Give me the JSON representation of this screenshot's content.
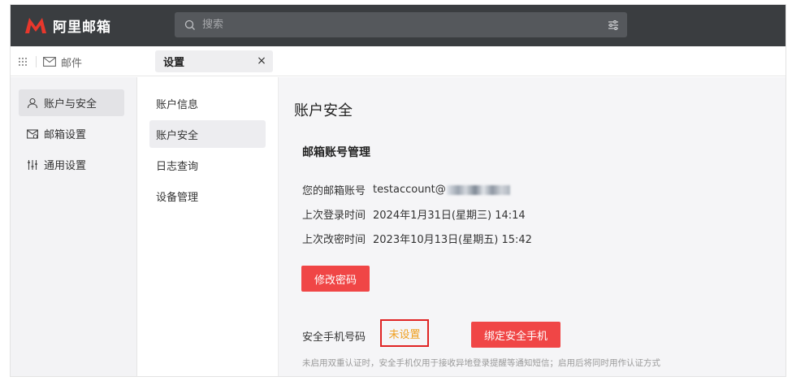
{
  "header": {
    "logo_text": "阿里邮箱",
    "search_placeholder": "搜索",
    "colors": {
      "bar": "#3a3d40",
      "brand_red": "#e8372c",
      "accent_red": "#f04646"
    }
  },
  "tabs": {
    "mail_label": "邮件",
    "settings_label": "设置",
    "close_glyph": "×"
  },
  "left_nav": {
    "items": [
      {
        "label": "账户与安全",
        "icon": "user-icon",
        "active": true
      },
      {
        "label": "邮箱设置",
        "icon": "mail-settings-icon",
        "active": false
      },
      {
        "label": "通用设置",
        "icon": "sliders-icon",
        "active": false
      }
    ]
  },
  "sub_nav": {
    "items": [
      {
        "label": "账户信息",
        "active": false
      },
      {
        "label": "账户安全",
        "active": true
      },
      {
        "label": "日志查询",
        "active": false
      },
      {
        "label": "设备管理",
        "active": false
      }
    ]
  },
  "main": {
    "page_title": "账户安全",
    "section_title": "邮箱账号管理",
    "account_label": "您的邮箱账号",
    "account_value": "testaccount@",
    "last_login_label": "上次登录时间",
    "last_login_value": "2024年1月31日(星期三) 14:14",
    "last_pwd_label": "上次改密时间",
    "last_pwd_value": "2023年10月13日(星期五) 15:42",
    "change_password_button": "修改密码",
    "phone_label": "安全手机号码",
    "phone_status": "未设置",
    "bind_phone_button": "绑定安全手机",
    "hint": "未启用双重认证时，安全手机仅用于接收异地登录提醒等通知短信；启用后将同时用作认证方式"
  }
}
